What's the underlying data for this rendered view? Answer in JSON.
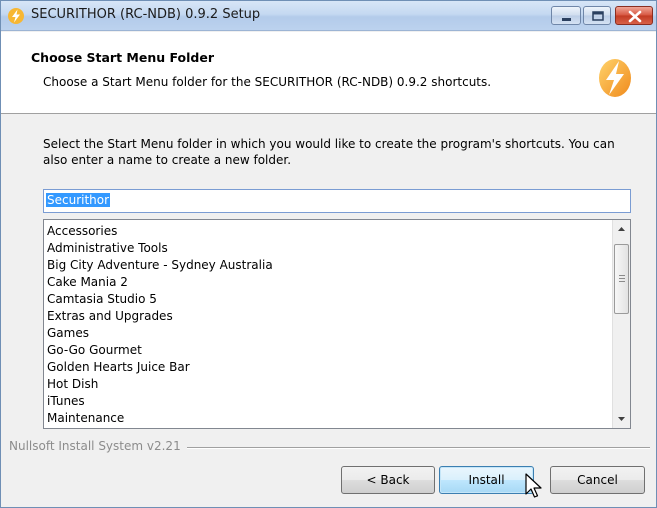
{
  "window": {
    "title": "SECURITHOR (RC-NDB) 0.9.2 Setup",
    "accent_color": "#f5a623"
  },
  "header": {
    "title": "Choose Start Menu Folder",
    "subtitle": "Choose a Start Menu folder for the SECURITHOR (RC-NDB) 0.9.2 shortcuts.",
    "icon": "lightning-bolt-icon"
  },
  "main": {
    "instructions": "Select the Start Menu folder in which you would like to create the program's shortcuts. You can also enter a name to create a new folder.",
    "folder_input": {
      "value": "Securithor"
    },
    "folder_list": [
      "Accessories",
      "Administrative Tools",
      "Big City Adventure - Sydney Australia",
      "Cake Mania 2",
      "Camtasia Studio 5",
      "Extras and Upgrades",
      "Games",
      "Go-Go Gourmet",
      "Golden Hearts Juice Bar",
      "Hot Dish",
      "iTunes",
      "Maintenance"
    ]
  },
  "footer": {
    "branding": "Nullsoft Install System v2.21",
    "back_label": "< Back",
    "install_label": "Install",
    "cancel_label": "Cancel"
  }
}
